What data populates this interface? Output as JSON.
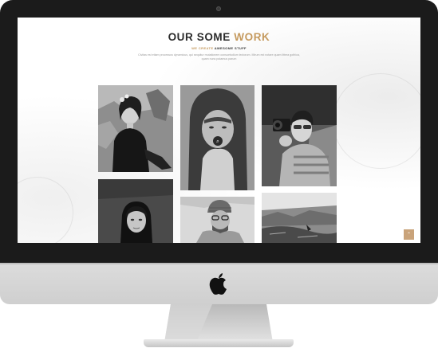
{
  "section": {
    "title_main": "OUR SOME",
    "title_accent": "WORK",
    "subtitle_accent": "WE CREATE",
    "subtitle_main": "AWESOME STUFF",
    "description": "Civitas est etiam processus dynamicus, qui sequitur mutationem consuetudium lectorum. Mirum est notare quam littera gothica, quam nunc putamus parum"
  },
  "gallery": {
    "items": [
      {
        "subject": "woman-with-hair-flowers",
        "tone": "dark"
      },
      {
        "subject": "boy-in-hoodie",
        "tone": "mid"
      },
      {
        "subject": "man-with-camera",
        "tone": "light"
      },
      {
        "subject": "woman-portrait",
        "tone": "dark"
      },
      {
        "subject": "man-in-beanie",
        "tone": "light"
      },
      {
        "subject": "landscape",
        "tone": "light"
      }
    ]
  },
  "icons": {
    "scroll_top": "chevron-up-icon",
    "brand": "apple-icon"
  },
  "colors": {
    "accent": "#c59a5e",
    "scroll_top_bg": "#c9a37a",
    "bezel": "#1b1b1b",
    "chin": "#d6d6d6"
  }
}
